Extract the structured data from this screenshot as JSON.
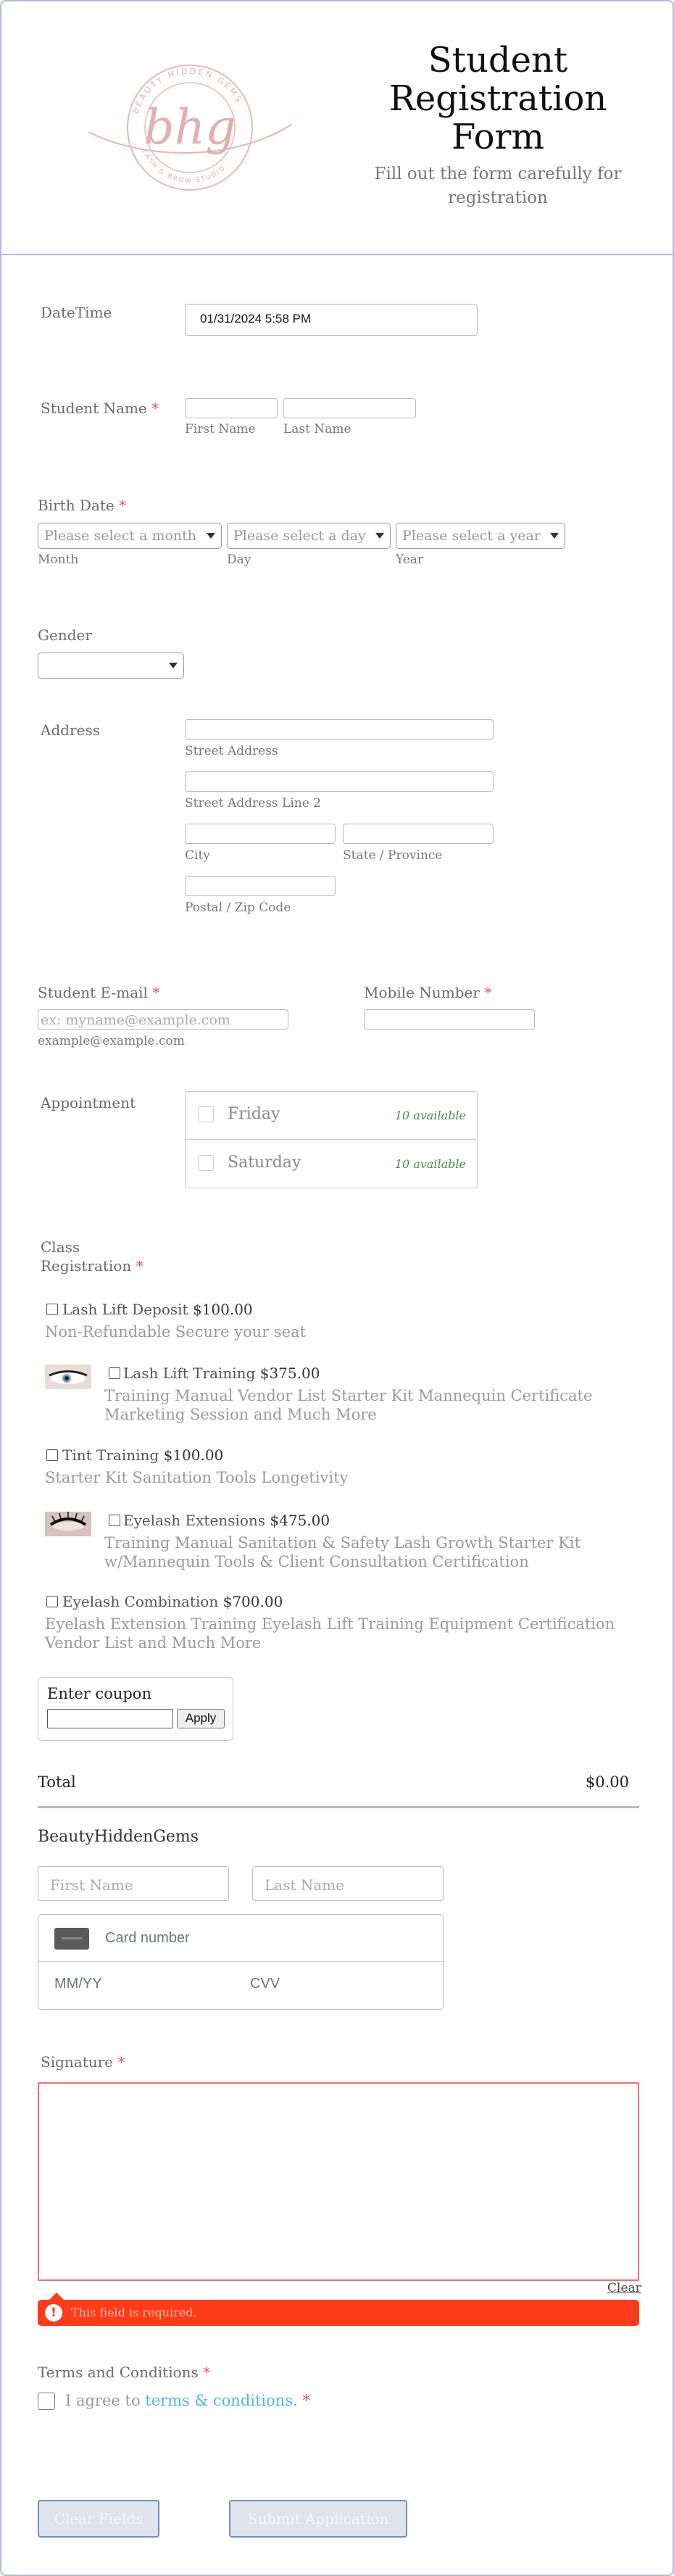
{
  "header": {
    "logo": {
      "monogram": "bhg",
      "ring_text": "BEAUTY HIDDEN GEMS",
      "ring_text_bottom": "LASH & BROW STUDIO"
    },
    "title_lines": [
      "Student",
      "Registration",
      "Form"
    ],
    "subtitle_lines": [
      "Fill out the form carefully for",
      "registration"
    ]
  },
  "datetime": {
    "label": "DateTime",
    "value": "01/31/2024 5:58 PM"
  },
  "student_name": {
    "label": "Student Name",
    "required": "*",
    "first_hint": "First Name",
    "last_hint": "Last Name"
  },
  "birth_date": {
    "label": "Birth Date",
    "required": "*",
    "month_placeholder": "Please select a month",
    "day_placeholder": "Please select a day",
    "year_placeholder": "Please select a year",
    "month_hint": "Month",
    "day_hint": "Day",
    "year_hint": "Year"
  },
  "gender": {
    "label": "Gender",
    "value": ""
  },
  "address": {
    "label": "Address",
    "street_hint": "Street Address",
    "street2_hint": "Street Address Line 2",
    "city_hint": "City",
    "state_hint": "State / Province",
    "zip_hint": "Postal / Zip Code"
  },
  "email": {
    "label": "Student E-mail",
    "required": "*",
    "placeholder": "ex: myname@example.com",
    "hint": "example@example.com"
  },
  "mobile": {
    "label": "Mobile Number",
    "required": "*"
  },
  "appointment": {
    "label": "Appointment",
    "options": [
      {
        "day": "Friday",
        "availability": "10 available"
      },
      {
        "day": "Saturday",
        "availability": "10 available"
      }
    ]
  },
  "class_registration": {
    "label_lines": [
      "Class",
      "Registration"
    ],
    "required": "*",
    "products": [
      {
        "name": "Lash Lift Deposit",
        "price": "$100.00",
        "description": "Non-Refundable Secure your seat"
      },
      {
        "name": "Lash Lift Training",
        "price": "$375.00",
        "description": "Training Manual Vendor List Starter Kit Mannequin Certificate Marketing Session and Much More"
      },
      {
        "name": "Tint Training",
        "price": "$100.00",
        "description": "Starter Kit Sanitation Tools Longetivity"
      },
      {
        "name": "Eyelash Extensions",
        "price": "$475.00",
        "description": "Training Manual Sanitation & Safety Lash Growth Starter Kit w/Mannequin Tools & Client Consultation Certification"
      },
      {
        "name": "Eyelash Combination",
        "price": "$700.00",
        "description": "Eyelash Extension Training Eyelash Lift Training Equipment Certification Vendor List and Much More"
      }
    ]
  },
  "coupon": {
    "label": "Enter coupon",
    "apply_label": "Apply"
  },
  "total": {
    "label": "Total",
    "value": "$0.00"
  },
  "payment": {
    "merchant": "BeautyHiddenGems",
    "first_placeholder": "First Name",
    "last_placeholder": "Last Name",
    "card_placeholder": "Card number",
    "expiry_placeholder": "MM/YY",
    "cvv_placeholder": "CVV"
  },
  "signature": {
    "label": "Signature",
    "required": "*",
    "clear_label": "Clear",
    "error": "This field is required."
  },
  "terms": {
    "label": "Terms and Conditions",
    "required": "*",
    "agree_prefix": "I agree to ",
    "link_text": "terms & conditions",
    "agree_suffix": ".",
    "agree_required": "*"
  },
  "buttons": {
    "clear": "Clear Fields",
    "submit": "Submit Application"
  },
  "colors": {
    "accent_link": "#4db6e8",
    "error": "#ff3b1a",
    "required": "#e05555",
    "border_blue": "#6f8fc4"
  }
}
